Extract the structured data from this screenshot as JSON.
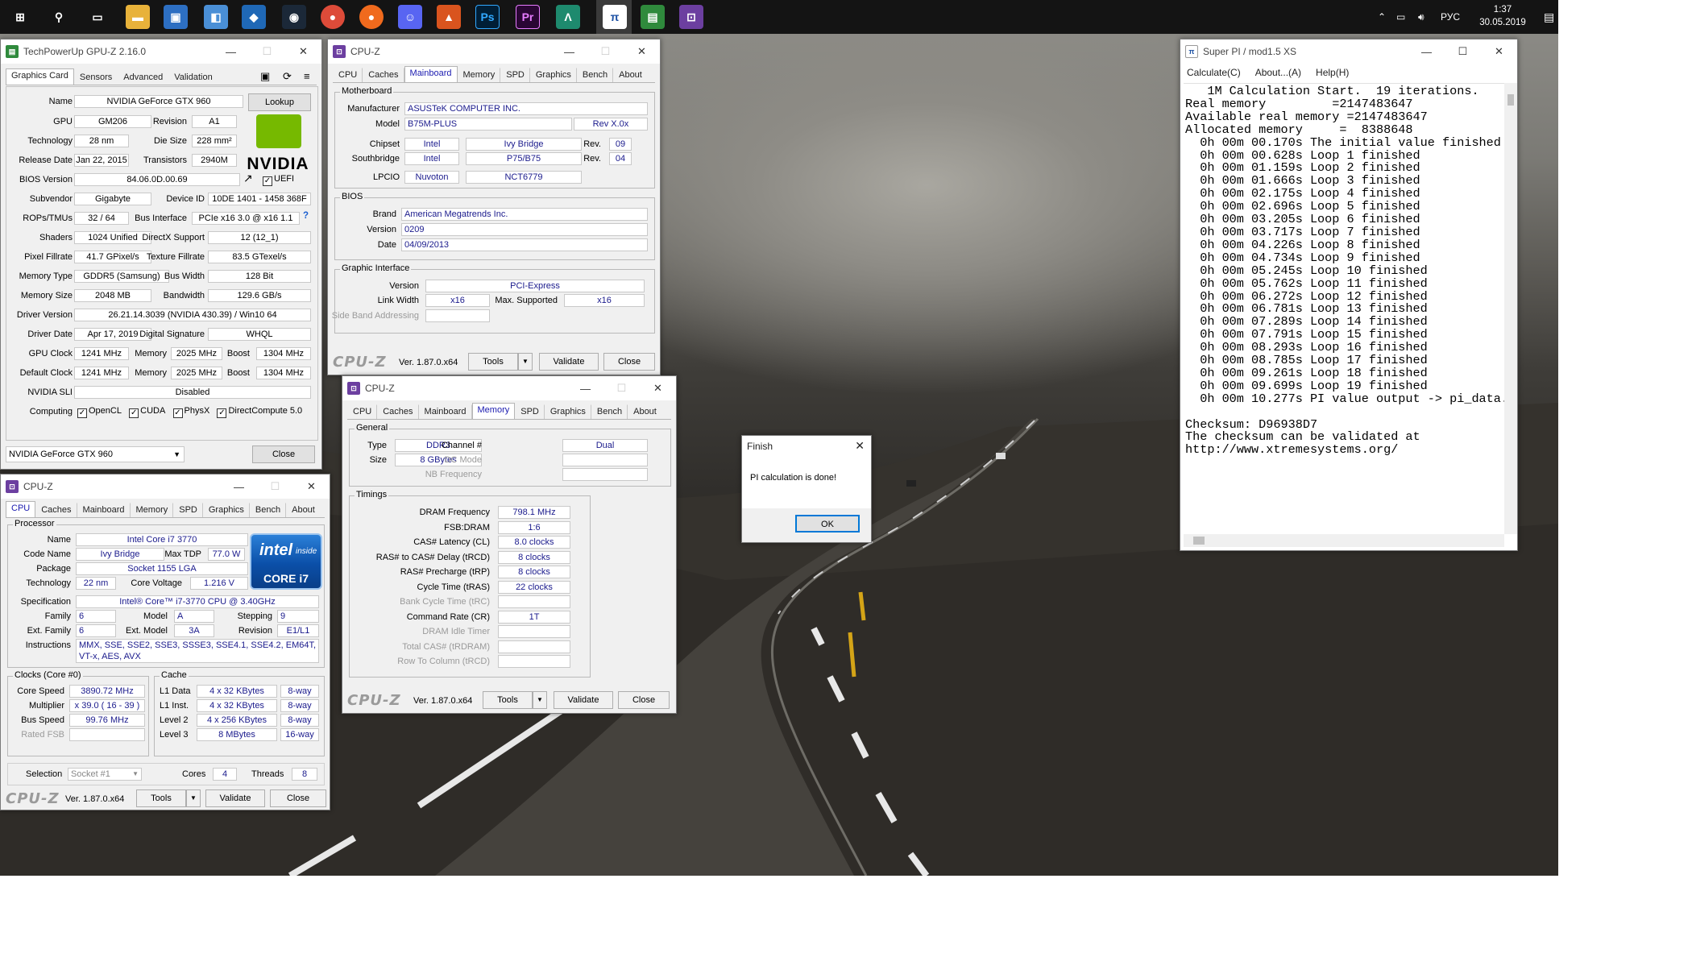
{
  "taskbar": {
    "lang": "РУС",
    "time": "1:37",
    "date": "30.05.2019"
  },
  "gpuz": {
    "title": "TechPowerUp GPU-Z 2.16.0",
    "tabs": [
      "Graphics Card",
      "Sensors",
      "Advanced",
      "Validation"
    ],
    "lookup": "Lookup",
    "labels": {
      "name": "Name",
      "gpu": "GPU",
      "revision": "Revision",
      "technology": "Technology",
      "die_size": "Die Size",
      "release_date": "Release Date",
      "transistors": "Transistors",
      "bios_version": "BIOS Version",
      "uefi": "UEFI",
      "subvendor": "Subvendor",
      "device_id": "Device ID",
      "rops": "ROPs/TMUs",
      "bus_interface": "Bus Interface",
      "shaders": "Shaders",
      "directx": "DirectX Support",
      "pixel_fillrate": "Pixel Fillrate",
      "texture_fillrate": "Texture Fillrate",
      "memory_type": "Memory Type",
      "bus_width": "Bus Width",
      "memory_size": "Memory Size",
      "bandwidth": "Bandwidth",
      "driver_version": "Driver Version",
      "driver_date": "Driver Date",
      "digital_signature": "Digital Signature",
      "gpu_clock": "GPU Clock",
      "memory": "Memory",
      "boost": "Boost",
      "default_clock": "Default Clock",
      "sli": "NVIDIA SLI",
      "computing": "Computing"
    },
    "values": {
      "name": "NVIDIA GeForce GTX 960",
      "gpu": "GM206",
      "revision": "A1",
      "technology": "28 nm",
      "die_size": "228 mm²",
      "release_date": "Jan 22, 2015",
      "transistors": "2940M",
      "bios_version": "84.06.0D.00.69",
      "subvendor": "Gigabyte",
      "device_id": "10DE 1401 - 1458 368F",
      "rops": "32 / 64",
      "bus_interface": "PCIe x16 3.0 @ x16 1.1",
      "shaders": "1024 Unified",
      "directx": "12 (12_1)",
      "pixel_fillrate": "41.7 GPixel/s",
      "texture_fillrate": "83.5 GTexel/s",
      "memory_type": "GDDR5 (Samsung)",
      "bus_width": "128 Bit",
      "memory_size": "2048 MB",
      "bandwidth": "129.6 GB/s",
      "driver_version": "26.21.14.3039 (NVIDIA 430.39) / Win10 64",
      "driver_date": "Apr 17, 2019",
      "digital_signature": "WHQL",
      "gpu_clock": "1241 MHz",
      "gpu_memory": "2025 MHz",
      "gpu_boost": "1304 MHz",
      "default_clock": "1241 MHz",
      "default_memory": "2025 MHz",
      "default_boost": "1304 MHz",
      "sli": "Disabled"
    },
    "computing": [
      "OpenCL",
      "CUDA",
      "PhysX",
      "DirectCompute 5.0"
    ],
    "nvidia_logo": "NVIDIA",
    "selected_gpu": "NVIDIA GeForce GTX 960",
    "close": "Close"
  },
  "cpuz_common": {
    "title": "CPU-Z",
    "tabs": [
      "CPU",
      "Caches",
      "Mainboard",
      "Memory",
      "SPD",
      "Graphics",
      "Bench",
      "About"
    ],
    "logo": "CPU-Z",
    "version": "Ver. 1.87.0.x64",
    "tools": "Tools",
    "validate": "Validate",
    "close": "Close"
  },
  "mainboard": {
    "group_mb": "Motherboard",
    "manufacturer_l": "Manufacturer",
    "manufacturer": "ASUSTeK COMPUTER INC.",
    "model_l": "Model",
    "model": "B75M-PLUS",
    "model_rev": "Rev X.0x",
    "chipset_l": "Chipset",
    "chipset_v": "Intel",
    "chipset_n": "Ivy Bridge",
    "rev_l": "Rev.",
    "chipset_rev": "09",
    "south_l": "Southbridge",
    "south_v": "Intel",
    "south_n": "P75/B75",
    "south_rev": "04",
    "lpcio_l": "LPCIO",
    "lpcio_v": "Nuvoton",
    "lpcio_n": "NCT6779",
    "group_bios": "BIOS",
    "brand_l": "Brand",
    "brand": "American Megatrends Inc.",
    "version_l": "Version",
    "version": "0209",
    "date_l": "Date",
    "date": "04/09/2013",
    "group_gi": "Graphic Interface",
    "gi_version_l": "Version",
    "gi_version": "PCI-Express",
    "link_l": "Link Width",
    "link": "x16",
    "max_l": "Max. Supported",
    "max": "x16",
    "sba_l": "Side Band Addressing"
  },
  "memory": {
    "group_general": "General",
    "type_l": "Type",
    "type": "DDR3",
    "channel_l": "Channel #",
    "channel": "Dual",
    "size_l": "Size",
    "size": "8 GBytes",
    "dcmode_l": "DC Mode",
    "nbfreq_l": "NB Frequency",
    "group_timings": "Timings",
    "timings": [
      {
        "label": "DRAM Frequency",
        "value": "798.1 MHz",
        "dim": false
      },
      {
        "label": "FSB:DRAM",
        "value": "1:6",
        "dim": false
      },
      {
        "label": "CAS# Latency (CL)",
        "value": "8.0 clocks",
        "dim": false
      },
      {
        "label": "RAS# to CAS# Delay (tRCD)",
        "value": "8 clocks",
        "dim": false
      },
      {
        "label": "RAS# Precharge (tRP)",
        "value": "8 clocks",
        "dim": false
      },
      {
        "label": "Cycle Time (tRAS)",
        "value": "22 clocks",
        "dim": false
      },
      {
        "label": "Bank Cycle Time (tRC)",
        "value": "",
        "dim": true
      },
      {
        "label": "Command Rate (CR)",
        "value": "1T",
        "dim": false
      },
      {
        "label": "DRAM Idle Timer",
        "value": "",
        "dim": true
      },
      {
        "label": "Total CAS# (tRDRAM)",
        "value": "",
        "dim": true
      },
      {
        "label": "Row To Column (tRCD)",
        "value": "",
        "dim": true
      }
    ]
  },
  "cpu": {
    "group_proc": "Processor",
    "name_l": "Name",
    "name": "Intel Core i7 3770",
    "code_l": "Code Name",
    "code": "Ivy Bridge",
    "tdp_l": "Max TDP",
    "tdp": "77.0 W",
    "package_l": "Package",
    "package": "Socket 1155 LGA",
    "tech_l": "Technology",
    "tech": "22 nm",
    "voltage_l": "Core Voltage",
    "voltage": "1.216 V",
    "spec_l": "Specification",
    "spec": "Intel® Core™ i7-3770 CPU @ 3.40GHz",
    "family_l": "Family",
    "family": "6",
    "model_l": "Model",
    "model": "A",
    "stepping_l": "Stepping",
    "stepping": "9",
    "extfam_l": "Ext. Family",
    "extfam": "6",
    "extmodel_l": "Ext. Model",
    "extmodel": "3A",
    "revision_l": "Revision",
    "revision": "E1/L1",
    "instr_l": "Instructions",
    "instr": "MMX, SSE, SSE2, SSE3, SSSE3, SSE4.1, SSE4.2, EM64T, VT-x, AES, AVX",
    "group_clocks": "Clocks (Core #0)",
    "core_speed_l": "Core Speed",
    "core_speed": "3890.72 MHz",
    "mult_l": "Multiplier",
    "mult": "x 39.0 ( 16 - 39 )",
    "bus_l": "Bus Speed",
    "bus": "99.76 MHz",
    "fsb_l": "Rated FSB",
    "group_cache": "Cache",
    "l1d_l": "L1 Data",
    "l1d": "4 x 32 KBytes",
    "l1d_w": "8-way",
    "l1i_l": "L1 Inst.",
    "l1i": "4 x 32 KBytes",
    "l1i_w": "8-way",
    "l2_l": "Level 2",
    "l2": "4 x 256 KBytes",
    "l2_w": "8-way",
    "l3_l": "Level 3",
    "l3": "8 MBytes",
    "l3_w": "16-way",
    "sel_l": "Selection",
    "sel": "Socket #1",
    "cores_l": "Cores",
    "cores": "4",
    "threads_l": "Threads",
    "threads": "8",
    "badge_top": "intel",
    "badge_inside": "inside",
    "badge_bottom": "CORE i7"
  },
  "superpi": {
    "title": "Super PI / mod1.5 XS",
    "menu": [
      "Calculate(C)",
      "About...(A)",
      "Help(H)"
    ],
    "lines": [
      "   1M Calculation Start.  19 iterations.",
      "Real memory         =2147483647",
      "Available real memory =2147483647",
      "Allocated memory     =  8388648",
      "  0h 00m 00.170s The initial value finished",
      "  0h 00m 00.628s Loop 1 finished",
      "  0h 00m 01.159s Loop 2 finished",
      "  0h 00m 01.666s Loop 3 finished",
      "  0h 00m 02.175s Loop 4 finished",
      "  0h 00m 02.696s Loop 5 finished",
      "  0h 00m 03.205s Loop 6 finished",
      "  0h 00m 03.717s Loop 7 finished",
      "  0h 00m 04.226s Loop 8 finished",
      "  0h 00m 04.734s Loop 9 finished",
      "  0h 00m 05.245s Loop 10 finished",
      "  0h 00m 05.762s Loop 11 finished",
      "  0h 00m 06.272s Loop 12 finished",
      "  0h 00m 06.781s Loop 13 finished",
      "  0h 00m 07.289s Loop 14 finished",
      "  0h 00m 07.791s Loop 15 finished",
      "  0h 00m 08.293s Loop 16 finished",
      "  0h 00m 08.785s Loop 17 finished",
      "  0h 00m 09.261s Loop 18 finished",
      "  0h 00m 09.699s Loop 19 finished",
      "  0h 00m 10.277s PI value output -> pi_data.txt",
      "",
      "Checksum: D96938D7",
      "The checksum can be validated at",
      "http://www.xtremesystems.org/"
    ]
  },
  "finish": {
    "title": "Finish",
    "message": "PI calculation is done!",
    "ok": "OK"
  }
}
